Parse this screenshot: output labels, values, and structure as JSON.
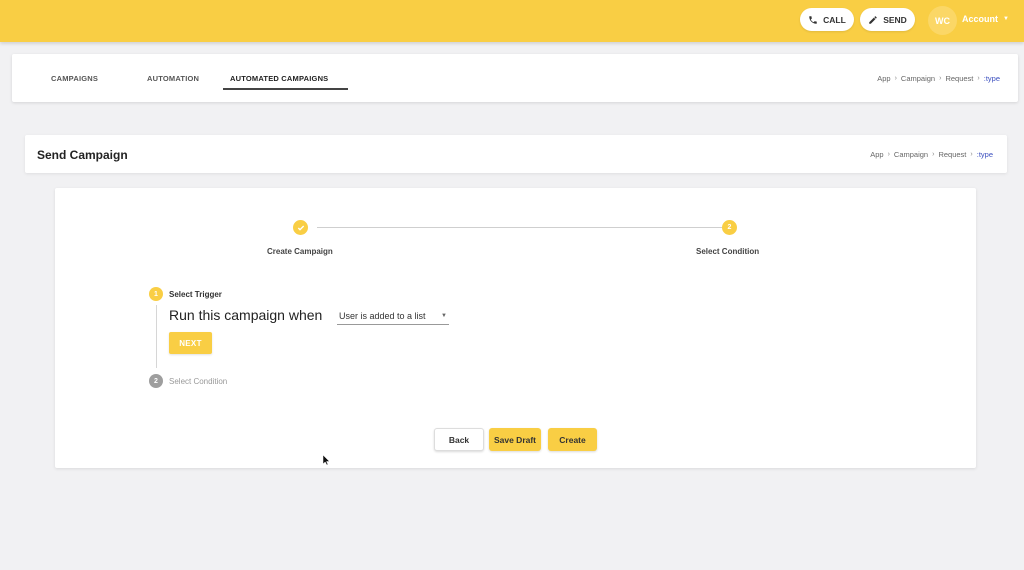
{
  "header": {
    "call_label": "CALL",
    "send_label": "SEND",
    "avatar_initials": "WC",
    "account_label": "Account",
    "accent_color": "#f9ce44"
  },
  "tabs": [
    {
      "label": "CAMPAIGNS"
    },
    {
      "label": "AUTOMATION"
    },
    {
      "label": "AUTOMATED CAMPAIGNS",
      "active": true
    }
  ],
  "breadcrumb_top": [
    "App",
    "Campaign",
    "Request",
    ":type"
  ],
  "page": {
    "title": "Send Campaign",
    "breadcrumb": [
      "App",
      "Campaign",
      "Request",
      ":type"
    ]
  },
  "stepper": {
    "steps": [
      {
        "label": "Create Campaign",
        "status": "complete",
        "icon": "check-icon"
      },
      {
        "label": "Select Condition",
        "number": "2"
      }
    ]
  },
  "vertical_steps": [
    {
      "number": "1",
      "label": "Select Trigger",
      "active": true
    },
    {
      "number": "2",
      "label": "Select Condition",
      "active": false
    }
  ],
  "trigger": {
    "prompt": "Run this campaign when",
    "selected": "User is added to a list",
    "next_label": "NEXT"
  },
  "actions": {
    "back_label": "Back",
    "save_draft_label": "Save Draft",
    "create_label": "Create"
  }
}
